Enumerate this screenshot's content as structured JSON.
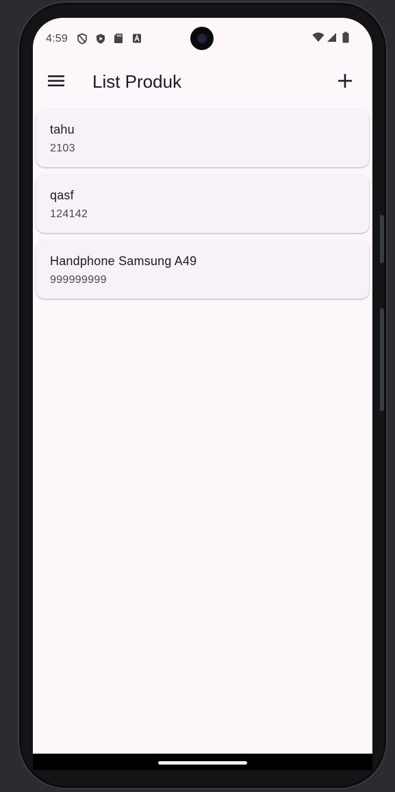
{
  "status_bar": {
    "time": "4:59"
  },
  "app_bar": {
    "title": "List Produk",
    "menu_icon": "hamburger-menu-icon",
    "add_icon": "plus-icon"
  },
  "products": [
    {
      "name": "tahu",
      "price": "2103"
    },
    {
      "name": "qasf",
      "price": "124142"
    },
    {
      "name": "Handphone Samsung A49",
      "price": "999999999"
    }
  ],
  "colors": {
    "background": "#fdf7fc",
    "card": "#f6f2f7",
    "text_primary": "#1d1b20",
    "text_secondary": "#49454f"
  }
}
